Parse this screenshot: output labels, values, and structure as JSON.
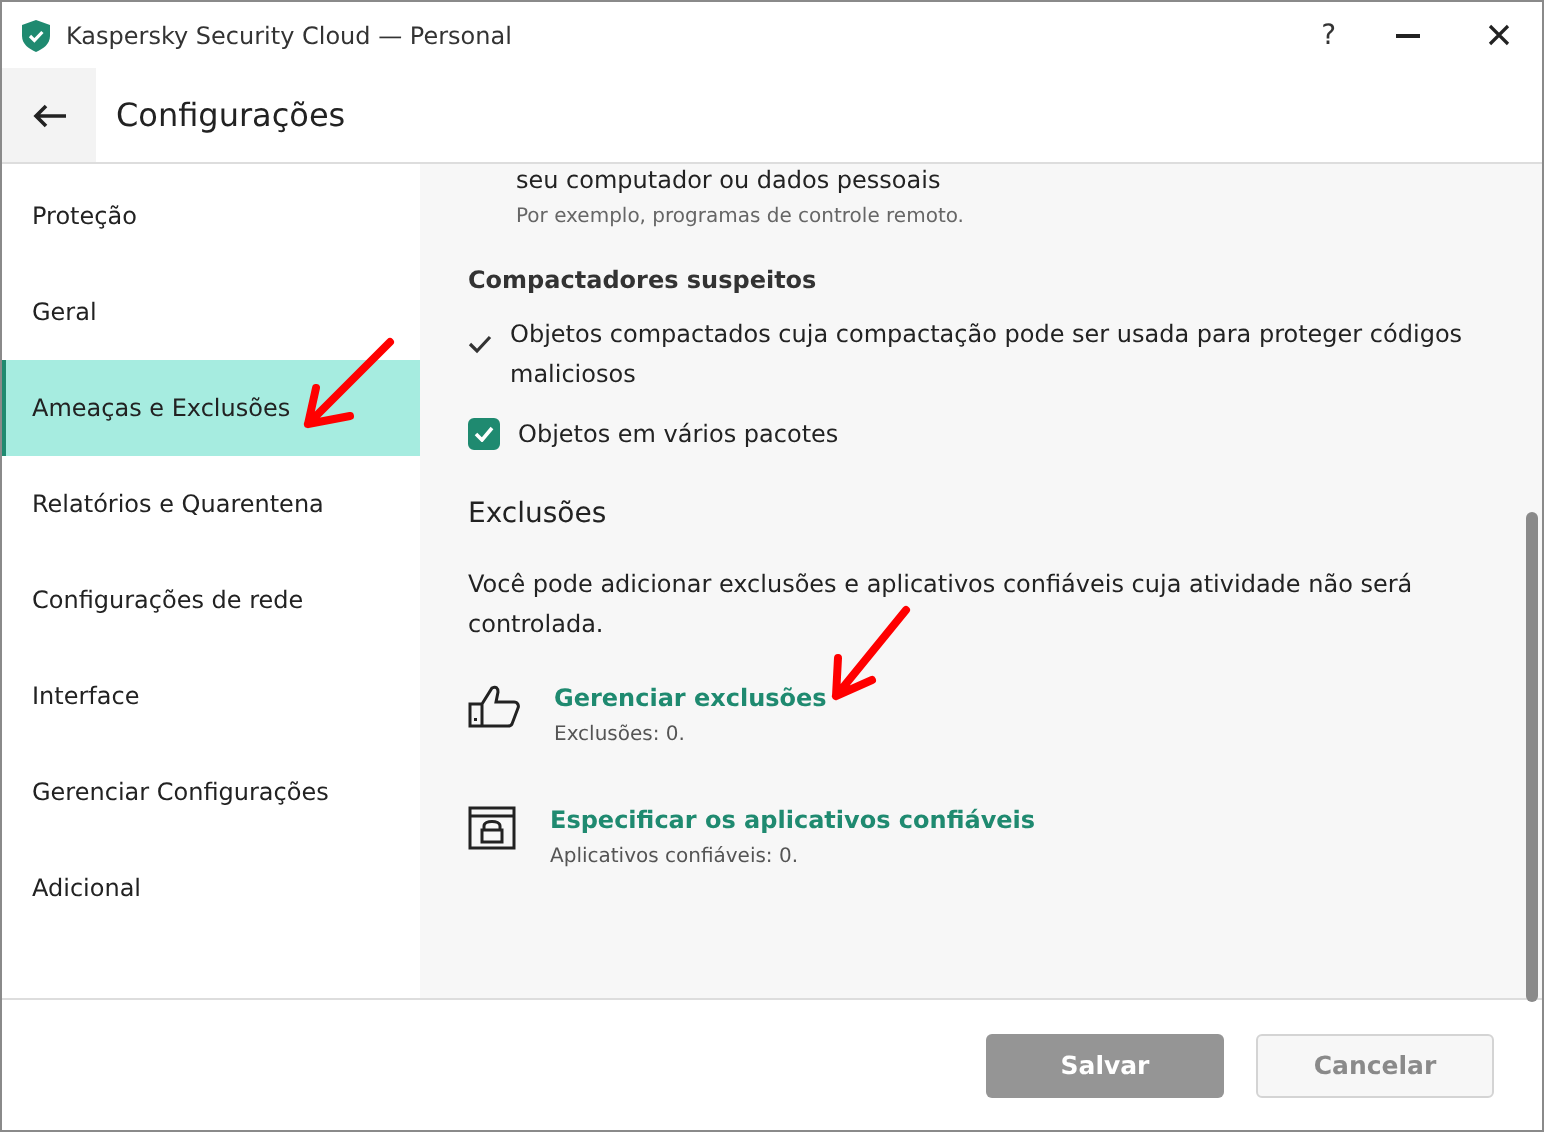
{
  "window": {
    "title": "Kaspersky Security Cloud — Personal",
    "controls": [
      "?"
    ]
  },
  "header": {
    "title": "Configurações"
  },
  "sidebar": {
    "items": [
      {
        "label": "Proteção",
        "selected": false
      },
      {
        "label": "Geral",
        "selected": false
      },
      {
        "label": "Ameaças e Exclusões",
        "selected": true
      },
      {
        "label": "Relatórios e Quarentena",
        "selected": false
      },
      {
        "label": "Configurações de rede",
        "selected": false
      },
      {
        "label": "Interface",
        "selected": false
      },
      {
        "label": "Gerenciar Configurações",
        "selected": false
      },
      {
        "label": "Adicional",
        "selected": false
      }
    ]
  },
  "content": {
    "cut_item": {
      "text": "seu computador ou dados pessoais",
      "hint": "Por exemplo, programas de controle remoto."
    },
    "packers": {
      "title": "Compactadores suspeitos",
      "options": [
        {
          "kind": "checkmark",
          "label": "Objetos compactados cuja compactação pode ser usada para proteger códigos maliciosos",
          "checked": true
        },
        {
          "kind": "checkbox",
          "label": "Objetos em vários pacotes",
          "checked": true
        }
      ]
    },
    "exclusions": {
      "title": "Exclusões",
      "description": "Você pode adicionar exclusões e aplicativos confiáveis cuja atividade não será controlada.",
      "links": [
        {
          "kind": "thumb",
          "label": "Gerenciar exclusões",
          "detail": "Exclusões: 0."
        },
        {
          "kind": "lock",
          "label": "Especificar os aplicativos confiáveis",
          "detail": "Aplicativos confiáveis: 0."
        }
      ]
    }
  },
  "footer": {
    "buttons": [
      {
        "label": "Salvar",
        "kind": "primary",
        "disabled": true
      },
      {
        "label": "Cancelar",
        "kind": "secondary",
        "disabled": true
      }
    ]
  }
}
